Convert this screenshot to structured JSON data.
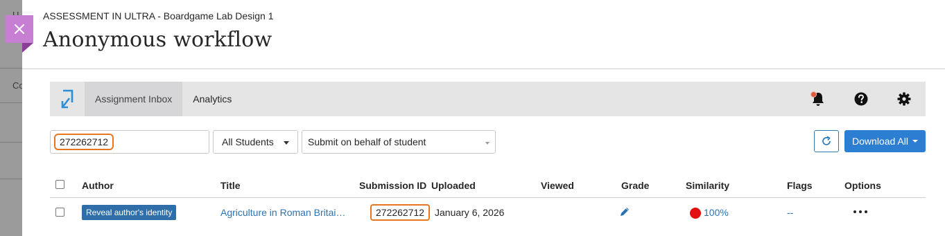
{
  "course": {
    "name": "ASSESSMENT IN ULTRA - Boardgame Lab Design 1",
    "page_title": "Anonymous workflow"
  },
  "background_page": {
    "char_top": "U",
    "char_mid": "Co"
  },
  "toolbar": {
    "tabs": [
      {
        "label": "Assignment Inbox",
        "active": true
      },
      {
        "label": "Analytics",
        "active": false
      }
    ],
    "icons": [
      "turnitin-logo-icon",
      "bell-icon",
      "help-icon",
      "gear-icon"
    ],
    "notification_color": "#e0593f"
  },
  "filters": {
    "search_value": "272262712",
    "students_select": "All Students",
    "behalf_select": "Submit on behalf of student",
    "download_label": "Download All"
  },
  "table": {
    "headers": {
      "author": "Author",
      "title": "Title",
      "submission_id": "Submission ID",
      "uploaded": "Uploaded",
      "viewed": "Viewed",
      "grade": "Grade",
      "similarity": "Similarity",
      "flags": "Flags",
      "options": "Options"
    },
    "rows": [
      {
        "reveal_label": "Reveal author's identity",
        "title": "Agriculture in Roman Britai…",
        "submission_id": "272262712",
        "uploaded": "January 6, 2026",
        "viewed": "",
        "similarity": "100%",
        "similarity_color": "#e10f0f",
        "flags": "--"
      }
    ]
  },
  "colors": {
    "accent": "#2b7ed1",
    "highlight": "#e8761f",
    "close_tab": "#c67fd3"
  }
}
